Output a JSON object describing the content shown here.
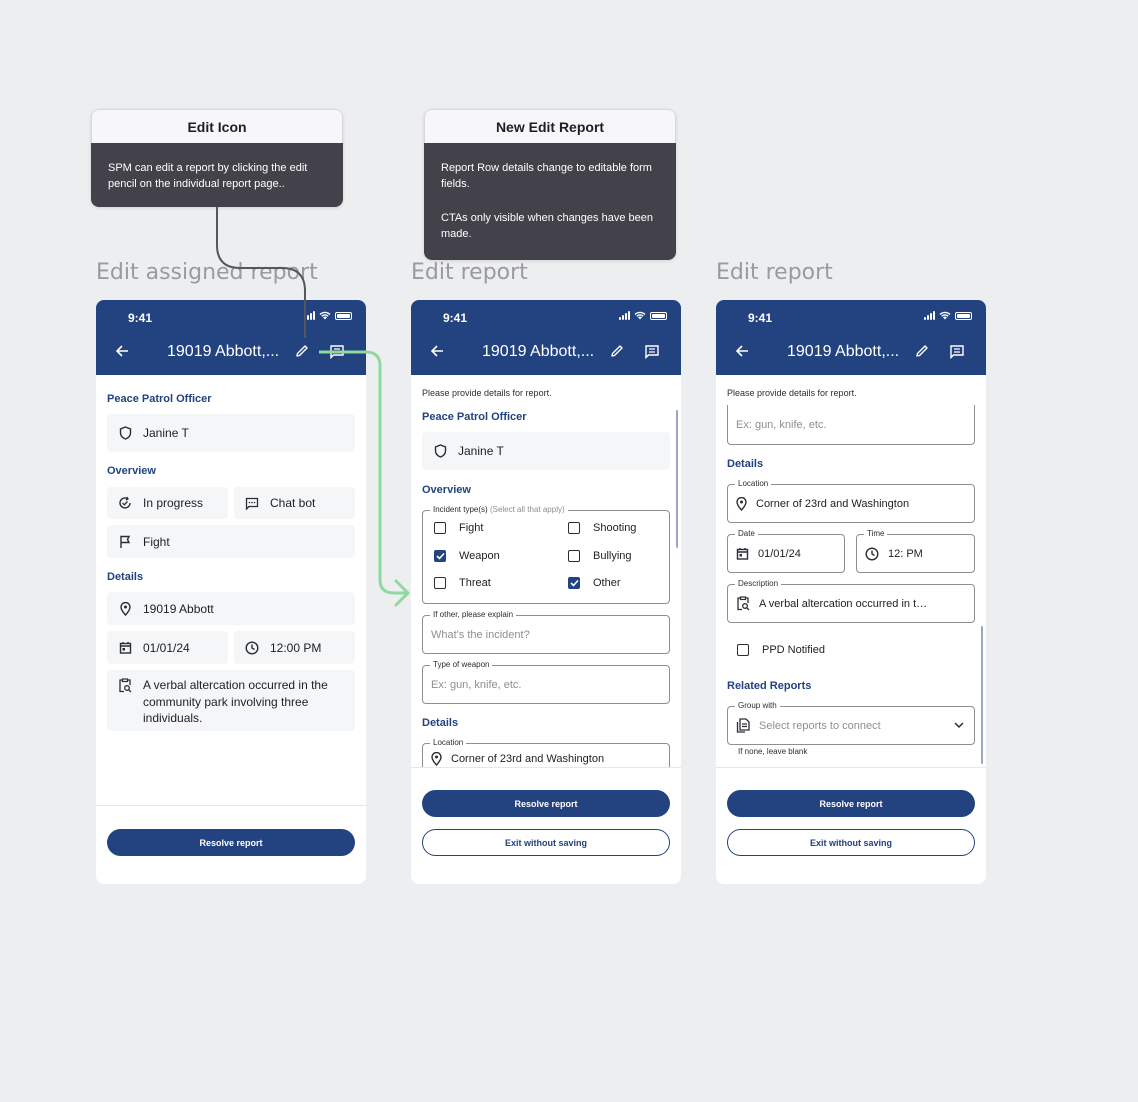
{
  "notes": {
    "edit_icon": {
      "title": "Edit Icon",
      "body": "SPM can edit a report by clicking the edit pencil on the individual report page.."
    },
    "new_edit_report": {
      "title": "New Edit Report",
      "body1": "Report Row details change to editable form fields.",
      "body2": "CTAs only visible when changes have been made."
    }
  },
  "screen_titles": {
    "s1": "Edit assigned report",
    "s2": "Edit report",
    "s3": "Edit report"
  },
  "status": {
    "time": "9:41"
  },
  "header": {
    "title": "19019 Abbott,...",
    "back_icon": "arrow-left-icon",
    "edit_icon": "pencil-icon",
    "chat_icon": "message-icon"
  },
  "screen1": {
    "officer_label": "Peace Patrol Officer",
    "officer_name": "Janine T",
    "overview_label": "Overview",
    "status": "In progress",
    "source": "Chat bot",
    "incident": "Fight",
    "details_label": "Details",
    "address": "19019 Abbott",
    "date": "01/01/24",
    "time": "12:00 PM",
    "description": "A verbal altercation occurred in the community park involving three individuals.",
    "resolve": "Resolve report"
  },
  "screen2": {
    "instruction": "Please provide details for report.",
    "officer_label": "Peace Patrol Officer",
    "officer_name": "Janine T",
    "overview_label": "Overview",
    "incident_legend": "Incident type(s)",
    "incident_hint": "(Select all that apply)",
    "options": [
      {
        "label": "Fight",
        "checked": false
      },
      {
        "label": "Shooting",
        "checked": false
      },
      {
        "label": "Weapon",
        "checked": true
      },
      {
        "label": "Bullying",
        "checked": false
      },
      {
        "label": "Threat",
        "checked": false
      },
      {
        "label": "Other",
        "checked": true
      }
    ],
    "other_legend": "If other, please explain",
    "other_placeholder": "What's the incident?",
    "weapon_legend": "Type of weapon",
    "weapon_placeholder": "Ex: gun, knife, etc.",
    "details_label": "Details",
    "location_legend": "Location",
    "location_value": "Corner of 23rd and Washington",
    "resolve": "Resolve report",
    "exit": "Exit without saving"
  },
  "screen3": {
    "instruction": "Please provide details for report.",
    "weapon_placeholder": "Ex: gun, knife, etc.",
    "details_label": "Details",
    "location_legend": "Location",
    "location_value": "Corner of 23rd and Washington",
    "date_legend": "Date",
    "date_value": "01/01/24",
    "time_legend": "Time",
    "time_value": "12: PM",
    "description_legend": "Description",
    "description_value": "A verbal altercation occurred in t…",
    "ppd_label": "PPD Notified",
    "ppd_checked": false,
    "related_label": "Related Reports",
    "group_legend": "Group with",
    "group_placeholder": "Select reports to connect",
    "group_hint": "If none, leave blank",
    "resolve": "Resolve report",
    "exit": "Exit without saving"
  },
  "colors": {
    "brand": "#22437f",
    "connector_green": "#8fd9a0",
    "connector_gray": "#56575c",
    "note_dark": "#43424a"
  }
}
